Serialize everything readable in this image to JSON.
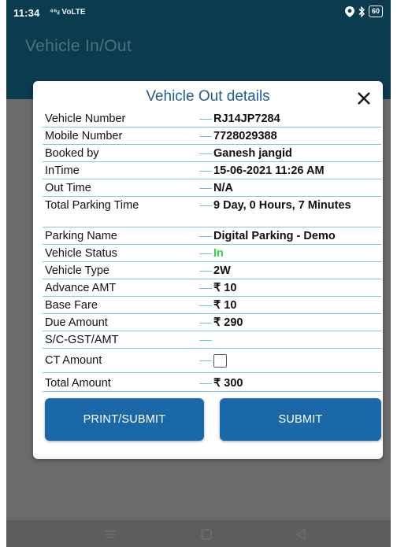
{
  "status_bar": {
    "time": "11:34",
    "network": "⁴⁶ᵢₗ VoLTE",
    "battery": "60"
  },
  "app_bar": {
    "title": "Vehicle In/Out"
  },
  "dialog": {
    "title": "Vehicle Out details",
    "rows": [
      {
        "label": "Vehicle Number",
        "value": "RJ14JP7284"
      },
      {
        "label": "Mobile Number",
        "value": "7728029388"
      },
      {
        "label": "Booked by",
        "value": "Ganesh jangid"
      },
      {
        "label": "InTime",
        "value": "15-06-2021 11:26 AM"
      },
      {
        "label": "Out Time",
        "value": "N/A"
      },
      {
        "label": "Total Parking Time",
        "value": "9 Day, 0 Hours, 7 Minutes"
      },
      {
        "label": "Parking Name",
        "value": "Digital Parking - Demo"
      },
      {
        "label": "Vehicle Status",
        "value": "In"
      },
      {
        "label": "Vehicle Type",
        "value": "2W"
      },
      {
        "label": "Advance AMT",
        "value": "₹ 10"
      },
      {
        "label": "Base Fare",
        "value": "₹ 10"
      },
      {
        "label": "Due Amount",
        "value": "₹ 290"
      },
      {
        "label": "S/C-GST/AMT",
        "value": ""
      },
      {
        "label": "CT Amount",
        "value": ""
      },
      {
        "label": "Total Amount",
        "value": "₹ 300"
      }
    ],
    "print_submit_label": "PRINT/SUBMIT",
    "submit_label": "SUBMIT"
  },
  "colors": {
    "header_bg": "#0b3b4f",
    "title": "#1f5e8f",
    "button": "#1a68a8",
    "divider": "#7fc7d9",
    "status_in": "#33d24a"
  },
  "icons": [
    "location-icon",
    "bluetooth-icon",
    "battery-icon",
    "close-icon",
    "checkbox-icon",
    "menu-icon",
    "home-icon",
    "back-icon"
  ]
}
